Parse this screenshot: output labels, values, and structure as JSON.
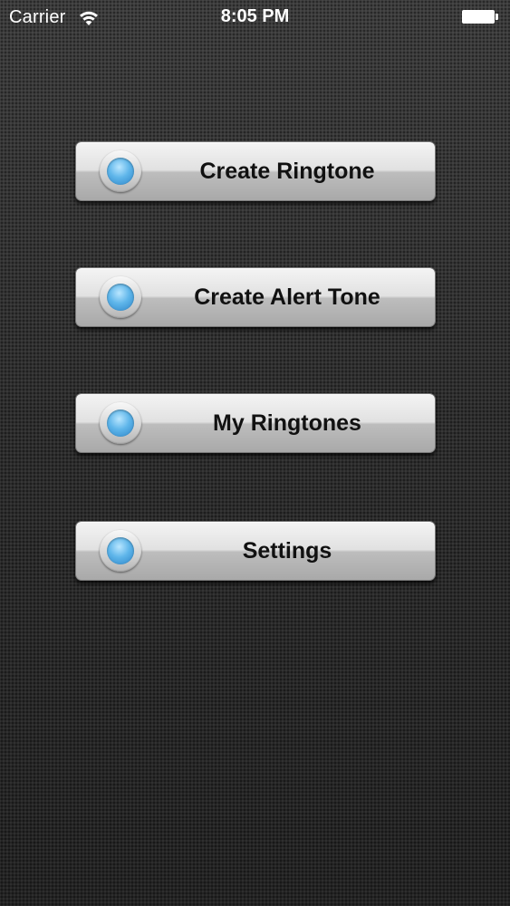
{
  "status_bar": {
    "carrier": "Carrier",
    "time": "8:05 PM",
    "wifi_icon": "wifi-icon",
    "battery_icon": "battery-full-icon"
  },
  "menu": {
    "items": [
      {
        "label": "Create Ringtone",
        "icon": "blue-led-icon"
      },
      {
        "label": "Create Alert Tone",
        "icon": "blue-led-icon"
      },
      {
        "label": "My Ringtones",
        "icon": "blue-led-icon"
      },
      {
        "label": "Settings",
        "icon": "blue-led-icon"
      }
    ]
  },
  "colors": {
    "background": "#2a2a2a",
    "button_face": "#e1e1e1",
    "led_blue": "#5fb6ea",
    "label_text": "#111111",
    "status_text": "#ffffff"
  }
}
